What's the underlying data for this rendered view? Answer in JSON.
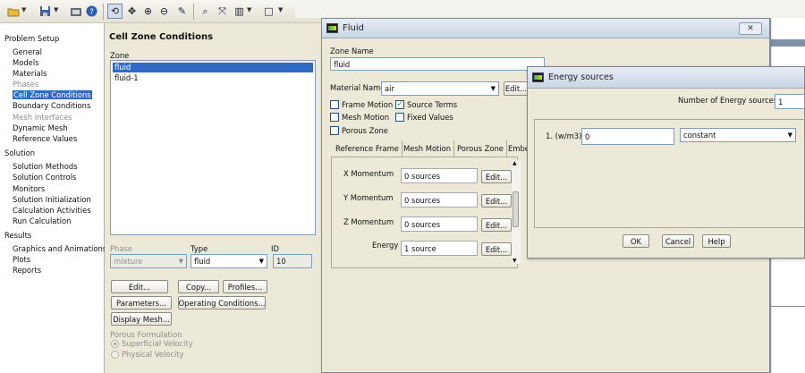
{
  "toolbar": {
    "icons": [
      "open-folder-icon",
      "save-icon",
      "screenshot-icon",
      "help-icon",
      "rotate-icon",
      "pan-icon",
      "zoom-in-icon",
      "zoom-out-icon",
      "probe-icon",
      "zoom-fit-icon",
      "vector-icon",
      "layout-icon",
      "window-icon"
    ]
  },
  "tree": {
    "problem_setup": "Problem Setup",
    "general": "General",
    "models": "Models",
    "materials": "Materials",
    "phases": "Phases",
    "cell_zone_conditions": "Cell Zone Conditions",
    "boundary_conditions": "Boundary Conditions",
    "mesh_interfaces": "Mesh Interfaces",
    "dynamic_mesh": "Dynamic Mesh",
    "reference_values": "Reference Values",
    "solution": "Solution",
    "solution_methods": "Solution Methods",
    "solution_controls": "Solution Controls",
    "monitors": "Monitors",
    "solution_initialization": "Solution Initialization",
    "calculation_activities": "Calculation Activities",
    "run_calculation": "Run Calculation",
    "results": "Results",
    "graphics_and_animations": "Graphics and Animations",
    "plots": "Plots",
    "reports": "Reports"
  },
  "panel": {
    "title": "Cell Zone Conditions",
    "zone_label": "Zone",
    "zones": [
      "fluid",
      "fluid-1"
    ],
    "phase_label": "Phase",
    "phase_value": "mixture",
    "type_label": "Type",
    "type_value": "fluid",
    "id_label": "ID",
    "id_value": "10",
    "edit": "Edit...",
    "copy": "Copy...",
    "profiles": "Profiles...",
    "parameters": "Parameters...",
    "operating_conditions": "Operating Conditions...",
    "display_mesh": "Display Mesh...",
    "porous_formulation": "Porous Formulation",
    "superficial_velocity": "Superficial Velocity",
    "physical_velocity": "Physical Velocity"
  },
  "fluid_dialog": {
    "title": "Fluid",
    "zone_name_label": "Zone Name",
    "zone_name_value": "fluid",
    "material_name_label": "Material Name",
    "material_value": "air",
    "edit": "Edit...",
    "frame_motion": "Frame Motion",
    "source_terms": "Source Terms",
    "mesh_motion": "Mesh Motion",
    "fixed_values": "Fixed Values",
    "porous_zone": "Porous Zone",
    "tabs": [
      "Reference Frame",
      "Mesh Motion",
      "Porous Zone",
      "Embe"
    ],
    "sources": [
      {
        "label": "X Momentum",
        "value": "0 sources",
        "button": "Edit..."
      },
      {
        "label": "Y Momentum",
        "value": "0 sources",
        "button": "Edit..."
      },
      {
        "label": "Z Momentum",
        "value": "0 sources",
        "button": "Edit..."
      },
      {
        "label": "Energy",
        "value": "1 source",
        "button": "Edit..."
      }
    ]
  },
  "energy_dialog": {
    "title": "Energy sources",
    "count_label": "Number of Energy sources",
    "count_value": "1",
    "row_label": "1. (w/m3)",
    "row_value": "0",
    "row_type": "constant",
    "ok": "OK",
    "cancel": "Cancel",
    "help": "Help"
  }
}
